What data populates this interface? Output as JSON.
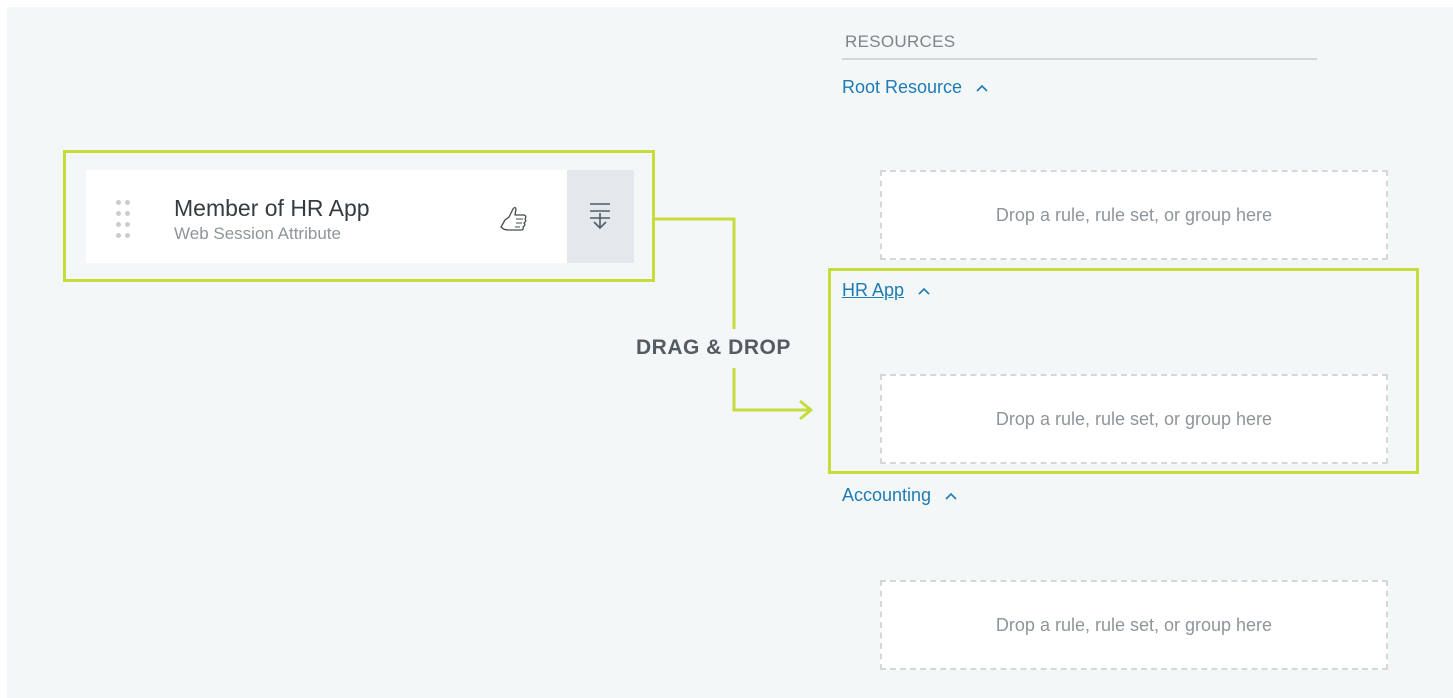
{
  "rule_card": {
    "title": "Member of HR App",
    "subtitle": "Web Session Attribute",
    "icons": [
      "drag-handle-icon",
      "thumbs-up-icon",
      "insert-below-icon"
    ]
  },
  "annotation": {
    "label": "DRAG & DROP"
  },
  "resources": {
    "heading": "RESOURCES",
    "items": [
      {
        "label": "Root Resource",
        "drop_text": "Drop a rule, rule set, or group here"
      },
      {
        "label": "HR App",
        "drop_text": "Drop a rule, rule set, or group here"
      },
      {
        "label": "Accounting",
        "drop_text": "Drop a rule, rule set, or group here"
      }
    ]
  },
  "colors": {
    "highlight": "#c5dc3c",
    "link": "#1e7bb3",
    "background": "#f4f7f8"
  }
}
